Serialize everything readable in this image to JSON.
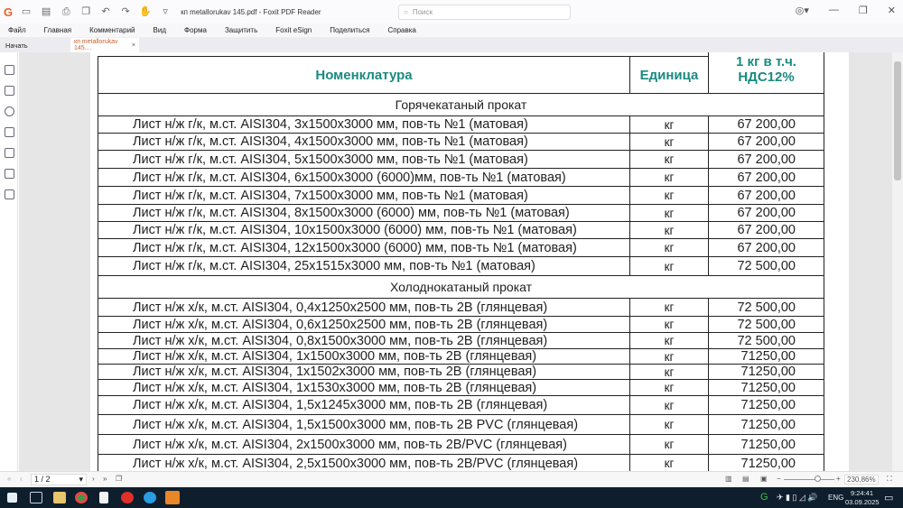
{
  "app": {
    "title": "кп metallorukav 145.pdf - Foxit PDF Reader",
    "search_placeholder": "Поиск"
  },
  "menu": [
    "Файл",
    "Главная",
    "Комментарий",
    "Вид",
    "Форма",
    "Защитить",
    "Foxit eSign",
    "Поделиться",
    "Справка"
  ],
  "tabs": {
    "home": "Начать",
    "doc": "кп metallorukav 145....",
    "close": "×"
  },
  "table": {
    "headers": {
      "name": "Номенклатура",
      "unit": "Единица",
      "price": "1 кг в т.ч. НДС12%"
    },
    "header_color": "#1a8a80",
    "sections": [
      {
        "title": "Горячекатаный прокат",
        "rows": [
          {
            "name": "Лист н/ж г/к, м.ст. AISI304, 3x1500x3000 мм, пов-ть №1 (матовая)",
            "unit": "кг",
            "price": "67 200,00"
          },
          {
            "name": "Лист н/ж г/к, м.ст. AISI304, 4x1500x3000 мм, пов-ть №1 (матовая)",
            "unit": "кг",
            "price": "67 200,00"
          },
          {
            "name": "Лист н/ж г/к, м.ст. AISI304, 5x1500x3000 мм, пов-ть №1 (матовая)",
            "unit": "кг",
            "price": "67 200,00"
          },
          {
            "name": "Лист н/ж г/к, м.ст. AISI304, 6x1500x3000 (6000)мм, пов-ть №1 (матовая)",
            "unit": "кг",
            "price": "67 200,00"
          },
          {
            "name": "Лист н/ж г/к, м.ст. AISI304, 7x1500x3000 мм, пов-ть №1 (матовая)",
            "unit": "кг",
            "price": "67 200,00"
          },
          {
            "name": "Лист н/ж г/к, м.ст. AISI304, 8x1500x3000 (6000) мм, пов-ть №1 (матовая)",
            "unit": "кг",
            "price": "67 200,00"
          },
          {
            "name": "Лист н/ж г/к, м.ст. AISI304, 10x1500x3000 (6000) мм, пов-ть №1 (матовая)",
            "unit": "кг",
            "price": "67 200,00"
          },
          {
            "name": "Лист н/ж г/к, м.ст. AISI304, 12x1500x3000 (6000) мм, пов-ть №1 (матовая)",
            "unit": "кг",
            "price": "67 200,00"
          },
          {
            "name": "Лист н/ж г/к, м.ст. AISI304, 25x1515x3000 мм, пов-ть №1 (матовая)",
            "unit": "кг",
            "price": "72 500,00"
          }
        ]
      },
      {
        "title": "Холоднокатаный прокат",
        "rows": [
          {
            "name": "Лист н/ж х/к, м.ст. AISI304, 0,4x1250x2500 мм, пов-ть 2В (глянцевая)",
            "unit": "кг",
            "price": "72 500,00"
          },
          {
            "name": "Лист н/ж х/к, м.ст. AISI304, 0,6x1250x2500 мм, пов-ть 2В (глянцевая)",
            "unit": "кг",
            "price": "72 500,00"
          },
          {
            "name": "Лист н/ж х/к, м.ст. AISI304, 0,8x1500x3000 мм, пов-ть 2В (глянцевая)",
            "unit": "кг",
            "price": "72 500,00"
          },
          {
            "name": "Лист н/ж х/к, м.ст. AISI304, 1x1500x3000 мм, пов-ть 2В (глянцевая)",
            "unit": "кг",
            "price": "71250,00"
          },
          {
            "name": "Лист н/ж х/к, м.ст. AISI304, 1x1502x3000 мм, пов-ть 2В (глянцевая)",
            "unit": "кг",
            "price": "71250,00"
          },
          {
            "name": "Лист н/ж х/к, м.ст. AISI304, 1x1530x3000 мм, пов-ть 2В (глянцевая)",
            "unit": "кг",
            "price": "71250,00"
          },
          {
            "name": "Лист н/ж х/к, м.ст. AISI304, 1,5x1245x3000 мм, пов-ть 2В (глянцевая)",
            "unit": "кг",
            "price": "71250,00"
          },
          {
            "name": "Лист н/ж х/к, м.ст. AISI304, 1,5x1500x3000 мм, пов-ть 2В PVC (глянцевая)",
            "unit": "кг",
            "price": "71250,00"
          },
          {
            "name": "Лист н/ж х/к, м.ст. AISI304, 2x1500x3000 мм, пов-ть 2В/PVC (глянцевая)",
            "unit": "кг",
            "price": "71250,00"
          },
          {
            "name": "Лист н/ж х/к, м.ст. AISI304, 2,5x1500x3000 мм, пов-ть 2В/PVC (глянцевая)",
            "unit": "кг",
            "price": "71250,00"
          }
        ]
      }
    ]
  },
  "status": {
    "page": "1 / 2",
    "zoom": "230,86%"
  },
  "taskbar": {
    "lang": "ENG",
    "time": "9:24:41",
    "date": "03.09.2025"
  }
}
